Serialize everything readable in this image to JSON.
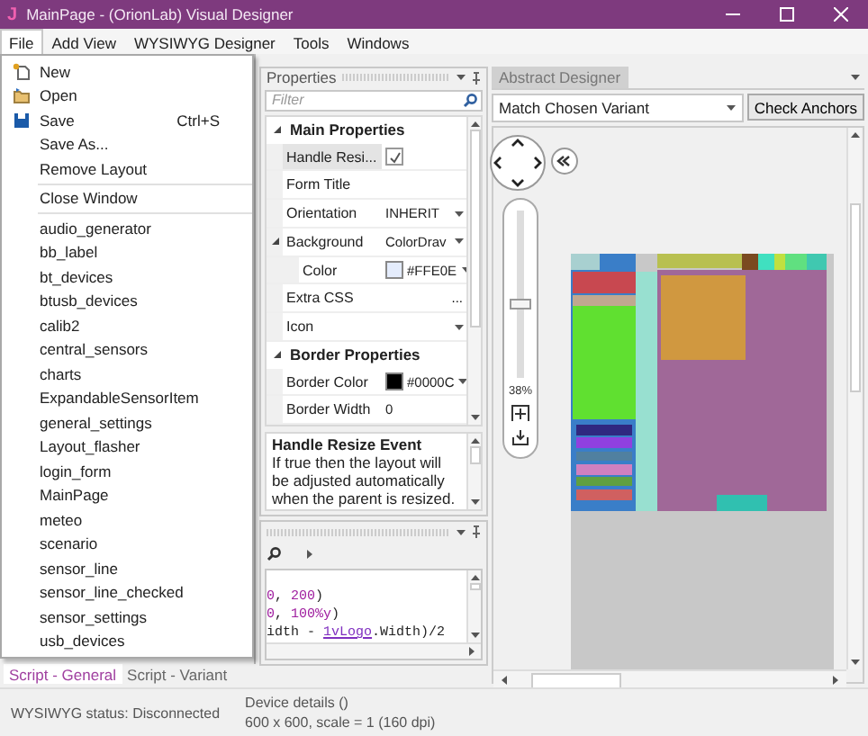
{
  "window": {
    "title": "MainPage - (OrionLab) Visual Designer",
    "app_icon": "J"
  },
  "menu_bar": [
    {
      "label": "File",
      "selected": true
    },
    {
      "label": "Add View",
      "selected": false
    },
    {
      "label": "WYSIWYG Designer",
      "selected": false
    },
    {
      "label": "Tools",
      "selected": false
    },
    {
      "label": "Windows",
      "selected": false
    }
  ],
  "file_menu": {
    "commands": [
      {
        "label": "New"
      },
      {
        "label": "Open"
      },
      {
        "label": "Save",
        "shortcut": "Ctrl+S"
      },
      {
        "label": "Save As..."
      },
      {
        "label": "Remove Layout"
      }
    ],
    "close": "Close Window",
    "layouts": [
      "audio_generator",
      "bb_label",
      "bt_devices",
      "btusb_devices",
      "calib2",
      "central_sensors",
      "charts",
      "ExpandableSensorItem",
      "general_settings",
      "Layout_flasher",
      "login_form",
      "MainPage",
      "meteo",
      "scenario",
      "sensor_line",
      "sensor_line_checked",
      "sensor_settings",
      "usb_devices"
    ]
  },
  "properties": {
    "title": "Properties",
    "filter": {
      "placeholder": "Filter"
    },
    "categories": [
      {
        "name": "Main Properties",
        "expanded": true,
        "rows": [
          {
            "name": "Handle Resi...",
            "kind": "check",
            "checked": true,
            "selected": true
          },
          {
            "name": "Form Title",
            "kind": "text",
            "selected": false
          },
          {
            "name": "Orientation",
            "kind": "dropdown",
            "value": "INHERIT",
            "selected": false
          },
          {
            "name": "Background",
            "kind": "dropdown",
            "value": "ColorDrav",
            "selected": false,
            "expanded": true,
            "children": [
              {
                "name": "Color",
                "kind": "color",
                "value": "#FFE0E",
                "color": "#e4ecfc",
                "selected": false
              }
            ]
          },
          {
            "name": "Extra CSS",
            "kind": "button",
            "value": "...",
            "selected": false
          },
          {
            "name": "Icon",
            "kind": "dropdown",
            "selected": false
          }
        ]
      },
      {
        "name": "Border Properties",
        "expanded": true,
        "rows": [
          {
            "name": "Border Color",
            "kind": "color",
            "value": "#0000C",
            "color": "#000000",
            "selected": false
          },
          {
            "name": "Border Width",
            "kind": "text",
            "value": "0",
            "selected": false
          }
        ]
      }
    ],
    "description": {
      "title": "Handle Resize Event",
      "text": "If true then the layout will be adjusted automatically when the parent is resized."
    }
  },
  "script": {
    "code_lines": [
      [
        {
          "kind": "number",
          "text": "0"
        },
        {
          "kind": "plain",
          "text": ", "
        },
        {
          "kind": "number",
          "text": "200"
        },
        {
          "kind": "plain",
          "text": ")"
        }
      ],
      [
        {
          "kind": "number",
          "text": "0"
        },
        {
          "kind": "plain",
          "text": ", "
        },
        {
          "kind": "number",
          "text": "100%y"
        },
        {
          "kind": "plain",
          "text": ")"
        }
      ],
      [
        {
          "kind": "plain",
          "text": "idth - "
        },
        {
          "kind": "ident",
          "text": "1vLogo"
        },
        {
          "kind": "plain",
          "text": ".Width)/2"
        }
      ]
    ]
  },
  "bottom_tabs": [
    {
      "label": "Script - General",
      "selected": true
    },
    {
      "label": "Script - Variant",
      "selected": false
    }
  ],
  "designer": {
    "tab": "Abstract Designer",
    "variant": "Match Chosen Variant",
    "check_button": "Check Anchors",
    "zoom": {
      "reading": "38%",
      "level": 0.43
    }
  },
  "status_bar": {
    "status": "WYSIWYG status: Disconnected",
    "device": "Device details ()",
    "resolution": "600 x 600, scale = 1 (160 dpi)"
  }
}
